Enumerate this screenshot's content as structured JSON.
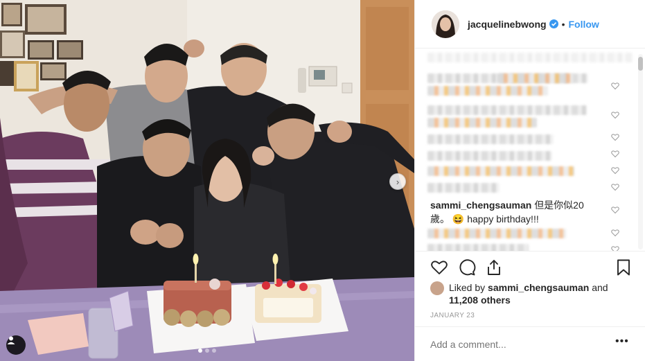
{
  "post": {
    "username": "jacquelinebwong",
    "verified": true,
    "header_separator": "•",
    "follow_label": "Follow",
    "photo_alt": "Birthday group photo with two cakes",
    "carousel": {
      "count": 3,
      "active": 0
    },
    "next_arrow": "›"
  },
  "comments": {
    "visible_comment": {
      "username": "sammi_chengsauman",
      "text": "但是你似20歲。 😆 happy birthday!!!"
    }
  },
  "likes": {
    "prefix": "Liked by",
    "user": "sammi_chengsauman",
    "conjunction": "and",
    "others": "11,208 others"
  },
  "date": "JANUARY 23",
  "add_comment": {
    "placeholder": "Add a comment...",
    "more": "•••"
  },
  "icons": {
    "heart": "heart-icon",
    "comment": "comment-icon",
    "share": "share-icon",
    "bookmark": "bookmark-icon",
    "user_tag": "user-icon",
    "verified": "verified-badge-icon"
  },
  "colors": {
    "link": "#3897f0",
    "text": "#262626",
    "muted": "#999999",
    "border": "#efefef"
  }
}
